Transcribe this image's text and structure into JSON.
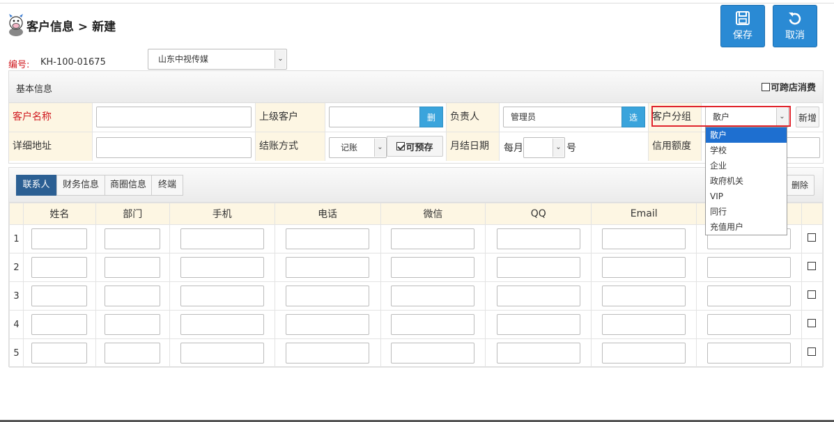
{
  "header": {
    "title": "客户信息 > 新建"
  },
  "actions": {
    "save": "保存",
    "cancel": "取消"
  },
  "record": {
    "code_label": "编号:",
    "code_value": "KH-100-01675",
    "store": "山东中视传媒"
  },
  "basic": {
    "title": "基本信息",
    "cross_store": "可跨店消费",
    "customer_name_label": "客户名称",
    "customer_name": "",
    "parent_label": "上级客户",
    "parent_value": "",
    "parent_delete": "删",
    "owner_label": "负责人",
    "owner_value": "管理员",
    "owner_pick": "选",
    "group_label": "客户分组",
    "group_value": "散户",
    "group_add": "新增",
    "address_label": "详细地址",
    "address_value": "",
    "settle_label": "结账方式",
    "settle_value": "记账",
    "prepay_label": "可预存",
    "monthly_label": "月结日期",
    "monthly_prefix": "每月",
    "monthly_value": "",
    "monthly_suffix": "号",
    "credit_label": "信用额度",
    "credit_value": ""
  },
  "group_options": [
    "散户",
    "学校",
    "企业",
    "政府机关",
    "VIP",
    "同行",
    "充值用户"
  ],
  "tabs": [
    "联系人",
    "财务信息",
    "商圈信息",
    "终端"
  ],
  "delete_label": "删除",
  "columns": [
    "姓名",
    "部门",
    "手机",
    "电话",
    "微信",
    "QQ",
    "Email",
    ""
  ],
  "rows": [
    "1",
    "2",
    "3",
    "4",
    "5"
  ]
}
